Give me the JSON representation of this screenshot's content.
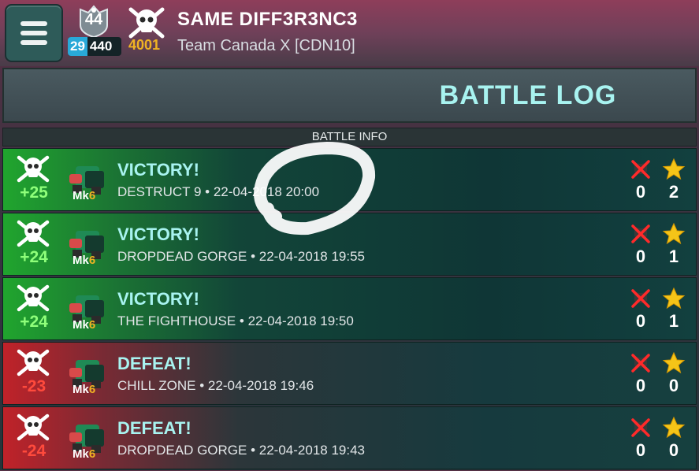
{
  "header": {
    "menu_icon": "hamburger-menu-icon",
    "rank_number": "44",
    "level": "29",
    "xp": "440",
    "skull_count": "4001",
    "player_name": "SAME DIFF3R3NC3",
    "team": "Team Canada X [CDN10]"
  },
  "title": "BATTLE LOG",
  "section_label": "BATTLE INFO",
  "colors": {
    "accent_text": "#a8f3f0",
    "win": "#20a52e",
    "loss": "#c02229",
    "gold": "#f0b323"
  },
  "battles": [
    {
      "result": "VICTORY!",
      "trophies": "+25",
      "mk_label": "Mk",
      "mk_level": "6",
      "map": "DESTRUCT 9",
      "datetime": "22-04-2018 20:00",
      "kills": "0",
      "stars": "2",
      "outcome": "win"
    },
    {
      "result": "VICTORY!",
      "trophies": "+24",
      "mk_label": "Mk",
      "mk_level": "6",
      "map": "DROPDEAD GORGE",
      "datetime": "22-04-2018 19:55",
      "kills": "0",
      "stars": "1",
      "outcome": "win"
    },
    {
      "result": "VICTORY!",
      "trophies": "+24",
      "mk_label": "Mk",
      "mk_level": "6",
      "map": "THE FIGHTHOUSE",
      "datetime": "22-04-2018 19:50",
      "kills": "0",
      "stars": "1",
      "outcome": "win"
    },
    {
      "result": "DEFEAT!",
      "trophies": "-23",
      "mk_label": "Mk",
      "mk_level": "6",
      "map": "CHILL ZONE",
      "datetime": "22-04-2018 19:46",
      "kills": "0",
      "stars": "0",
      "outcome": "loss"
    },
    {
      "result": "DEFEAT!",
      "trophies": "-24",
      "mk_label": "Mk",
      "mk_level": "6",
      "map": "DROPDEAD GORGE",
      "datetime": "22-04-2018 19:43",
      "kills": "0",
      "stars": "0",
      "outcome": "loss"
    }
  ]
}
